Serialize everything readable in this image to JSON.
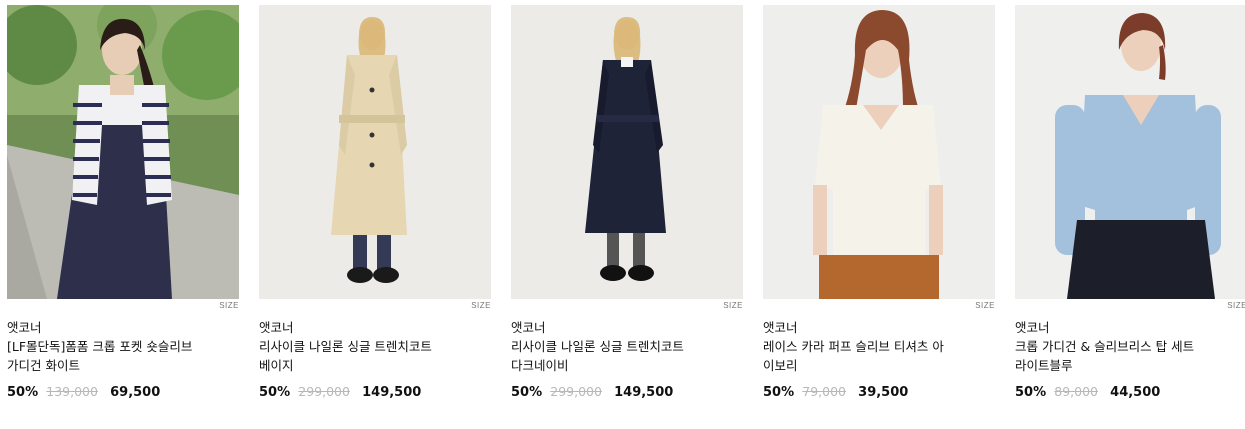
{
  "products": [
    {
      "brand": "앳코너",
      "name_line1": "[LF몰단독]폼폼 크롭 포켓 숏슬리브",
      "name_line2": "가디건 화이트",
      "size_label": "SIZE",
      "discount": "50%",
      "original_price": "139,000",
      "sale_price": "69,500"
    },
    {
      "brand": "앳코너",
      "name_line1": "리사이클 나일론 싱글 트렌치코트",
      "name_line2": "베이지",
      "size_label": "SIZE",
      "discount": "50%",
      "original_price": "299,000",
      "sale_price": "149,500"
    },
    {
      "brand": "앳코너",
      "name_line1": "리사이클 나일론 싱글 트렌치코트",
      "name_line2": "다크네이비",
      "size_label": "SIZE",
      "discount": "50%",
      "original_price": "299,000",
      "sale_price": "149,500"
    },
    {
      "brand": "앳코너",
      "name_line1": "레이스 카라 퍼프 슬리브 티셔츠 아",
      "name_line2": "이보리",
      "size_label": "SIZE",
      "discount": "50%",
      "original_price": "79,000",
      "sale_price": "39,500"
    },
    {
      "brand": "앳코너",
      "name_line1": "크롭 가디건 & 슬리브리스 탑 세트",
      "name_line2": "라이트블루",
      "size_label": "SIZE",
      "discount": "50%",
      "original_price": "89,000",
      "sale_price": "44,500"
    }
  ]
}
